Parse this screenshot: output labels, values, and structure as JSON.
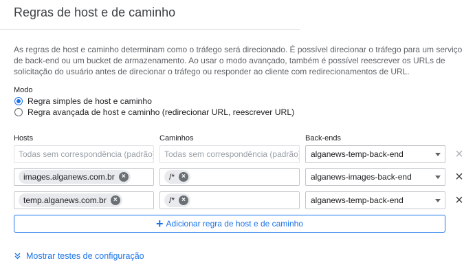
{
  "page": {
    "title": "Regras de host e de caminho",
    "description_lines": [
      "As regras de host e caminho determinam como o tráfego será direcionado. É possível direcionar o tráfego para um serviço",
      "de back-end ou um bucket de armazenamento. Ao usar o modo avançado, também é possível reescrever os URLs de",
      "solicitação do usuário antes de direcionar o tráfego ou responder ao cliente com redirecionamentos de URL."
    ]
  },
  "mode": {
    "label": "Modo",
    "options": [
      {
        "label": "Regra simples de host e caminho",
        "selected": true
      },
      {
        "label": "Regra avançada de host e caminho (redirecionar URL, reescrever URL)",
        "selected": false
      }
    ]
  },
  "columns": {
    "hosts": "Hosts",
    "paths": "Caminhos",
    "backends": "Back-ends"
  },
  "rules": [
    {
      "host_placeholder": "Todas sem correspondência (padrão)",
      "path_placeholder": "Todas sem correspondência (padrão)",
      "backend": "alganews-temp-back-end"
    },
    {
      "host": "images.alganews.com.br",
      "path": "/*",
      "backend": "alganews-images-back-end"
    },
    {
      "host": "temp.alganews.com.br",
      "path": "/*",
      "backend": "alganews-temp-back-end"
    }
  ],
  "icons": {
    "delete": "close-icon",
    "chip_remove": "cancel-circle-icon",
    "add": "plus-icon",
    "expand": "double-chevron-down-icon"
  },
  "add_rule_label": "Adicionar regra de host e de caminho",
  "show_tests_label": "Mostrar testes de configuração",
  "colors": {
    "accent": "#1a73e8",
    "text_secondary": "#5f6368",
    "chip_bg": "#e8eaed"
  }
}
